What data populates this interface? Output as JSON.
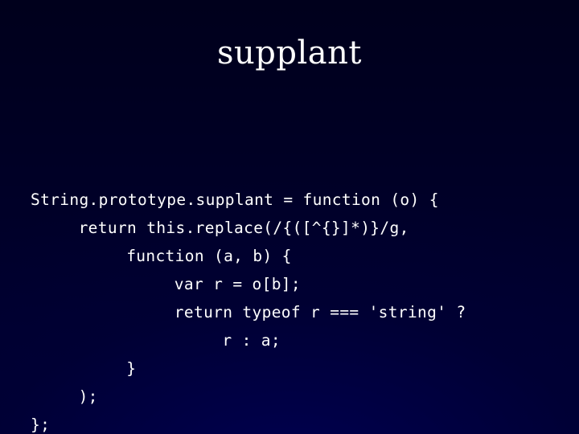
{
  "slide": {
    "title": "supplant",
    "background_color_top": "#00001e",
    "background_color_bottom": "#000033",
    "text_color": "#ffffff"
  },
  "code": {
    "language": "javascript",
    "indent_unit_chars": 4,
    "lines": [
      {
        "indent": 0,
        "text": "String.prototype.supplant = function (o) {"
      },
      {
        "indent": 4,
        "text": "return this.replace(/{([^{}]*)}/g,"
      },
      {
        "indent": 8,
        "text": "function (a, b) {"
      },
      {
        "indent": 12,
        "text": "var r = o[b];"
      },
      {
        "indent": 12,
        "text": "return typeof r === 'string' ?"
      },
      {
        "indent": 16,
        "text": "r : a;"
      },
      {
        "indent": 8,
        "text": "}"
      },
      {
        "indent": 4,
        "text": ");"
      },
      {
        "indent": 0,
        "text": "};"
      }
    ],
    "full_text": "String.prototype.supplant = function (o) {\n    return this.replace(/{([^{}]*)}/g,\n        function (a, b) {\n            var r = o[b];\n            return typeof r === 'string' ?\n                r : a;\n        }\n    );\n};"
  }
}
